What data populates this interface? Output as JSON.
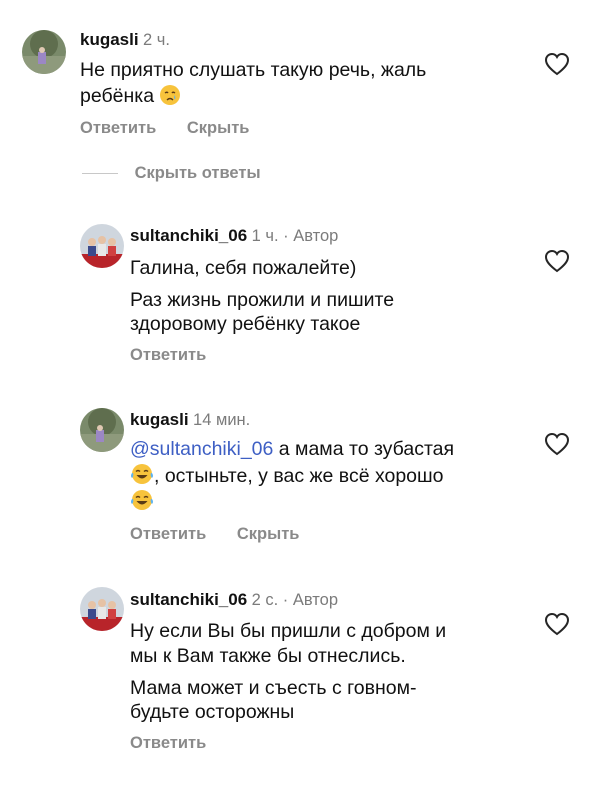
{
  "comments": [
    {
      "username": "kugasli",
      "time": "2 ч.",
      "lines": [
        "Не приятно слушать такую речь, жаль",
        "ребёнка"
      ],
      "emoji": "crying-face",
      "reply_label": "Ответить",
      "hide_label": "Скрыть"
    },
    {
      "username": "sultanchiki_06",
      "time": "1 ч. · Автор",
      "lines": [
        "Галина, себя пожалейте)",
        "Раз жизнь прожили и пишите",
        "здоровому ребёнку такое"
      ],
      "reply_label": "Ответить"
    },
    {
      "username": "kugasli",
      "time": "14 мин.",
      "mention": "@sultanchiki_06",
      "lines": [
        " а мама то зубастая",
        ", остыньте, у вас же всё хорошо",
        ""
      ],
      "emoji": "face-with-tears-of-joy",
      "reply_label": "Ответить",
      "hide_label": "Скрыть"
    },
    {
      "username": "sultanchiki_06",
      "time": "2 с. · Автор",
      "lines": [
        "Ну если Вы бы пришли с добром и",
        "мы к Вам также бы отнеслись.",
        "Мама может и съесть с говном-",
        "будьте осторожны"
      ],
      "reply_label": "Ответить"
    }
  ],
  "hide_replies_label": "Скрыть ответы",
  "icons": {
    "like": "heart-outline-icon"
  },
  "colors": {
    "mention": "#3e5fc4",
    "secondary_text": "#8a8a8a"
  }
}
